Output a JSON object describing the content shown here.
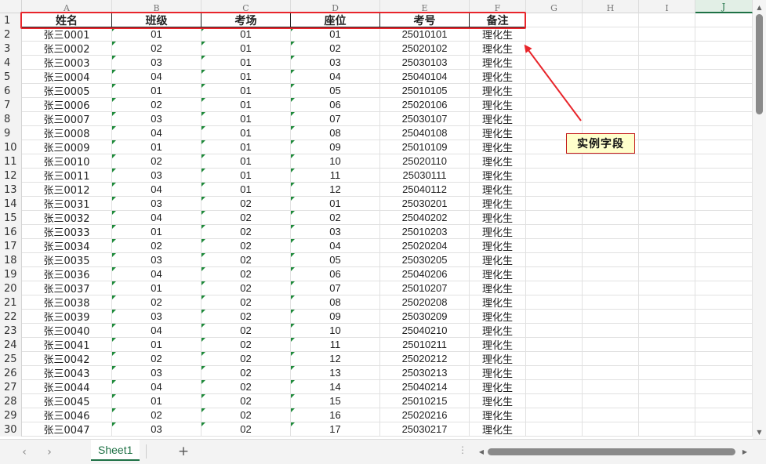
{
  "columns": [
    "A",
    "B",
    "C",
    "D",
    "E",
    "F",
    "G",
    "H",
    "I",
    "J"
  ],
  "active_column": "J",
  "header_row": {
    "row_number": "1",
    "cells": [
      "姓名",
      "班级",
      "考场",
      "座位",
      "考号",
      "备注"
    ]
  },
  "rows": [
    {
      "n": "2",
      "name": "张三0001",
      "class": "01",
      "room": "01",
      "seat": "01",
      "id": "25010101",
      "note": "理化生"
    },
    {
      "n": "3",
      "name": "张三0002",
      "class": "02",
      "room": "01",
      "seat": "02",
      "id": "25020102",
      "note": "理化生"
    },
    {
      "n": "4",
      "name": "张三0003",
      "class": "03",
      "room": "01",
      "seat": "03",
      "id": "25030103",
      "note": "理化生"
    },
    {
      "n": "5",
      "name": "张三0004",
      "class": "04",
      "room": "01",
      "seat": "04",
      "id": "25040104",
      "note": "理化生"
    },
    {
      "n": "6",
      "name": "张三0005",
      "class": "01",
      "room": "01",
      "seat": "05",
      "id": "25010105",
      "note": "理化生"
    },
    {
      "n": "7",
      "name": "张三0006",
      "class": "02",
      "room": "01",
      "seat": "06",
      "id": "25020106",
      "note": "理化生"
    },
    {
      "n": "8",
      "name": "张三0007",
      "class": "03",
      "room": "01",
      "seat": "07",
      "id": "25030107",
      "note": "理化生"
    },
    {
      "n": "9",
      "name": "张三0008",
      "class": "04",
      "room": "01",
      "seat": "08",
      "id": "25040108",
      "note": "理化生"
    },
    {
      "n": "10",
      "name": "张三0009",
      "class": "01",
      "room": "01",
      "seat": "09",
      "id": "25010109",
      "note": "理化生"
    },
    {
      "n": "11",
      "name": "张三0010",
      "class": "02",
      "room": "01",
      "seat": "10",
      "id": "25020110",
      "note": "理化生"
    },
    {
      "n": "12",
      "name": "张三0011",
      "class": "03",
      "room": "01",
      "seat": "11",
      "id": "25030111",
      "note": "理化生"
    },
    {
      "n": "13",
      "name": "张三0012",
      "class": "04",
      "room": "01",
      "seat": "12",
      "id": "25040112",
      "note": "理化生"
    },
    {
      "n": "14",
      "name": "张三0031",
      "class": "03",
      "room": "02",
      "seat": "01",
      "id": "25030201",
      "note": "理化生"
    },
    {
      "n": "15",
      "name": "张三0032",
      "class": "04",
      "room": "02",
      "seat": "02",
      "id": "25040202",
      "note": "理化生"
    },
    {
      "n": "16",
      "name": "张三0033",
      "class": "01",
      "room": "02",
      "seat": "03",
      "id": "25010203",
      "note": "理化生"
    },
    {
      "n": "17",
      "name": "张三0034",
      "class": "02",
      "room": "02",
      "seat": "04",
      "id": "25020204",
      "note": "理化生"
    },
    {
      "n": "18",
      "name": "张三0035",
      "class": "03",
      "room": "02",
      "seat": "05",
      "id": "25030205",
      "note": "理化生"
    },
    {
      "n": "19",
      "name": "张三0036",
      "class": "04",
      "room": "02",
      "seat": "06",
      "id": "25040206",
      "note": "理化生"
    },
    {
      "n": "20",
      "name": "张三0037",
      "class": "01",
      "room": "02",
      "seat": "07",
      "id": "25010207",
      "note": "理化生"
    },
    {
      "n": "21",
      "name": "张三0038",
      "class": "02",
      "room": "02",
      "seat": "08",
      "id": "25020208",
      "note": "理化生"
    },
    {
      "n": "22",
      "name": "张三0039",
      "class": "03",
      "room": "02",
      "seat": "09",
      "id": "25030209",
      "note": "理化生"
    },
    {
      "n": "23",
      "name": "张三0040",
      "class": "04",
      "room": "02",
      "seat": "10",
      "id": "25040210",
      "note": "理化生"
    },
    {
      "n": "24",
      "name": "张三0041",
      "class": "01",
      "room": "02",
      "seat": "11",
      "id": "25010211",
      "note": "理化生"
    },
    {
      "n": "25",
      "name": "张三0042",
      "class": "02",
      "room": "02",
      "seat": "12",
      "id": "25020212",
      "note": "理化生"
    },
    {
      "n": "26",
      "name": "张三0043",
      "class": "03",
      "room": "02",
      "seat": "13",
      "id": "25030213",
      "note": "理化生"
    },
    {
      "n": "27",
      "name": "张三0044",
      "class": "04",
      "room": "02",
      "seat": "14",
      "id": "25040214",
      "note": "理化生"
    },
    {
      "n": "28",
      "name": "张三0045",
      "class": "01",
      "room": "02",
      "seat": "15",
      "id": "25010215",
      "note": "理化生"
    },
    {
      "n": "29",
      "name": "张三0046",
      "class": "02",
      "room": "02",
      "seat": "16",
      "id": "25020216",
      "note": "理化生"
    },
    {
      "n": "30",
      "name": "张三0047",
      "class": "03",
      "room": "02",
      "seat": "17",
      "id": "25030217",
      "note": "理化生"
    }
  ],
  "annotation": {
    "label": "实例字段",
    "color": "#e8252b",
    "fill": "#ffffcc"
  },
  "sheet_tabs": {
    "active": "Sheet1",
    "add_label": "+",
    "prev_icon": "chevron-left-icon",
    "next_icon": "chevron-right-icon"
  },
  "colors": {
    "accent": "#1e7145",
    "text_indicator": "#1e8a3a"
  }
}
